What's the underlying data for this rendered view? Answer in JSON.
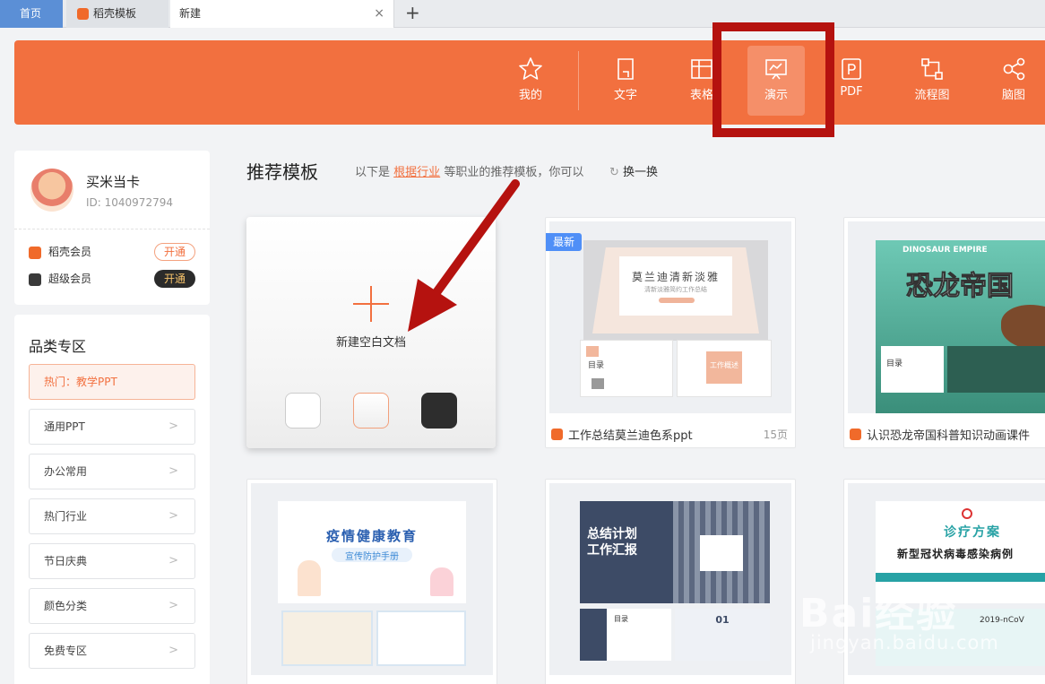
{
  "tabs": {
    "home": "首页",
    "templates": "稻壳模板",
    "new": "新建",
    "close": "×",
    "add": "+"
  },
  "categories": {
    "mine": "我的",
    "writer": "文字",
    "sheet": "表格",
    "present": "演示",
    "pdf": "PDF",
    "flow": "流程图",
    "mind": "脑图"
  },
  "user": {
    "name": "买米当卡",
    "id": "ID: 1040972794",
    "member1": "稻壳会员",
    "member2": "超级会员",
    "open1": "开通",
    "open2": "开通"
  },
  "sidebar": {
    "title": "品类专区",
    "items": [
      "热门：教学PPT",
      "通用PPT",
      "办公常用",
      "热门行业",
      "节日庆典",
      "颜色分类",
      "免费专区"
    ],
    "chevron": ">"
  },
  "section": {
    "title": "推荐模板",
    "desc_prefix": "以下是",
    "desc_link": "根据行业",
    "desc_suffix": "等职业的推荐模板，你可以",
    "refresh": "换一换"
  },
  "blank": {
    "label": "新建空白文档"
  },
  "cards": [
    {
      "title": "工作总结莫兰迪色系ppt",
      "pages": "15页",
      "badge": "最新",
      "thumb_title": "莫兰迪清新淡雅",
      "thumb_sub": "清新淡雅简约工作总结",
      "thumb_toc": "目录",
      "thumb_sec": "工作概述"
    },
    {
      "title": "认识恐龙帝国科普知识动画课件",
      "thumb_top": "DINOSAUR EMPIRE",
      "thumb_title": "恐龙帝国",
      "thumb_toc": "目录"
    },
    {
      "thumb_title": "疫情健康教育",
      "thumb_sub": "宣传防护手册"
    },
    {
      "thumb_title": "总结计划",
      "thumb_title2": "工作汇报",
      "thumb_toc": "目录",
      "thumb_num": "01"
    },
    {
      "thumb_title": "诊疗方案",
      "thumb_sub": "新型冠状病毒感染病例",
      "thumb_code": "2019-nCoV"
    }
  ],
  "watermark": {
    "logo": "Bai经验",
    "url": "jingyan.baidu.com"
  },
  "colors": {
    "accent": "#f2703f",
    "annotation": "#b5120f",
    "tab_active": "#5b8fd6"
  }
}
